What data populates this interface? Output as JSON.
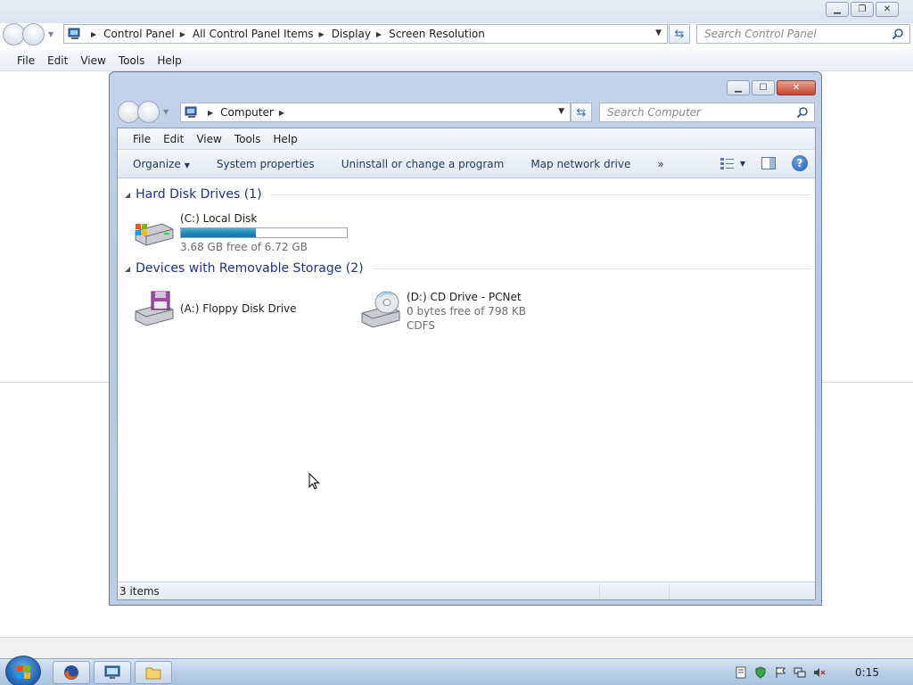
{
  "background_window": {
    "breadcrumb": [
      "Control Panel",
      "All Control Panel Items",
      "Display",
      "Screen Resolution"
    ],
    "search_placeholder": "Search Control Panel",
    "menu": [
      "File",
      "Edit",
      "View",
      "Tools",
      "Help"
    ]
  },
  "window": {
    "breadcrumb": [
      "Computer"
    ],
    "search_placeholder": "Search Computer",
    "menu": [
      "File",
      "Edit",
      "View",
      "Tools",
      "Help"
    ],
    "commands": {
      "organize": "Organize",
      "system_properties": "System properties",
      "uninstall": "Uninstall or change a program",
      "map_drive": "Map network drive",
      "more": "»",
      "help": "?"
    },
    "groups": {
      "hard_disks": {
        "title": "Hard Disk Drives (1)",
        "drives": [
          {
            "name": "(C:) Local Disk",
            "free_text": "3.68 GB free of 6.72 GB",
            "used_fraction": 0.45,
            "icon": "hard-drive-icon"
          }
        ]
      },
      "removable": {
        "title": "Devices with Removable Storage (2)",
        "drives": [
          {
            "name": "(A:) Floppy Disk Drive",
            "icon": "floppy-drive-icon"
          },
          {
            "name": "(D:) CD Drive - PCNet",
            "free_text": "0 bytes free of 798 KB",
            "filesystem": "CDFS",
            "icon": "cd-drive-icon"
          }
        ]
      }
    },
    "status": "3 items"
  },
  "taskbar": {
    "clock": "0:15",
    "pinned": [
      "firefox-icon",
      "remote-desktop-icon",
      "folder-icon"
    ],
    "tray": [
      "notes-icon",
      "security-icon",
      "flag-icon",
      "network-icon",
      "volume-muted-icon"
    ]
  },
  "colors": {
    "progress_fill": "#1a86b8",
    "group_header": "#1e3287"
  }
}
